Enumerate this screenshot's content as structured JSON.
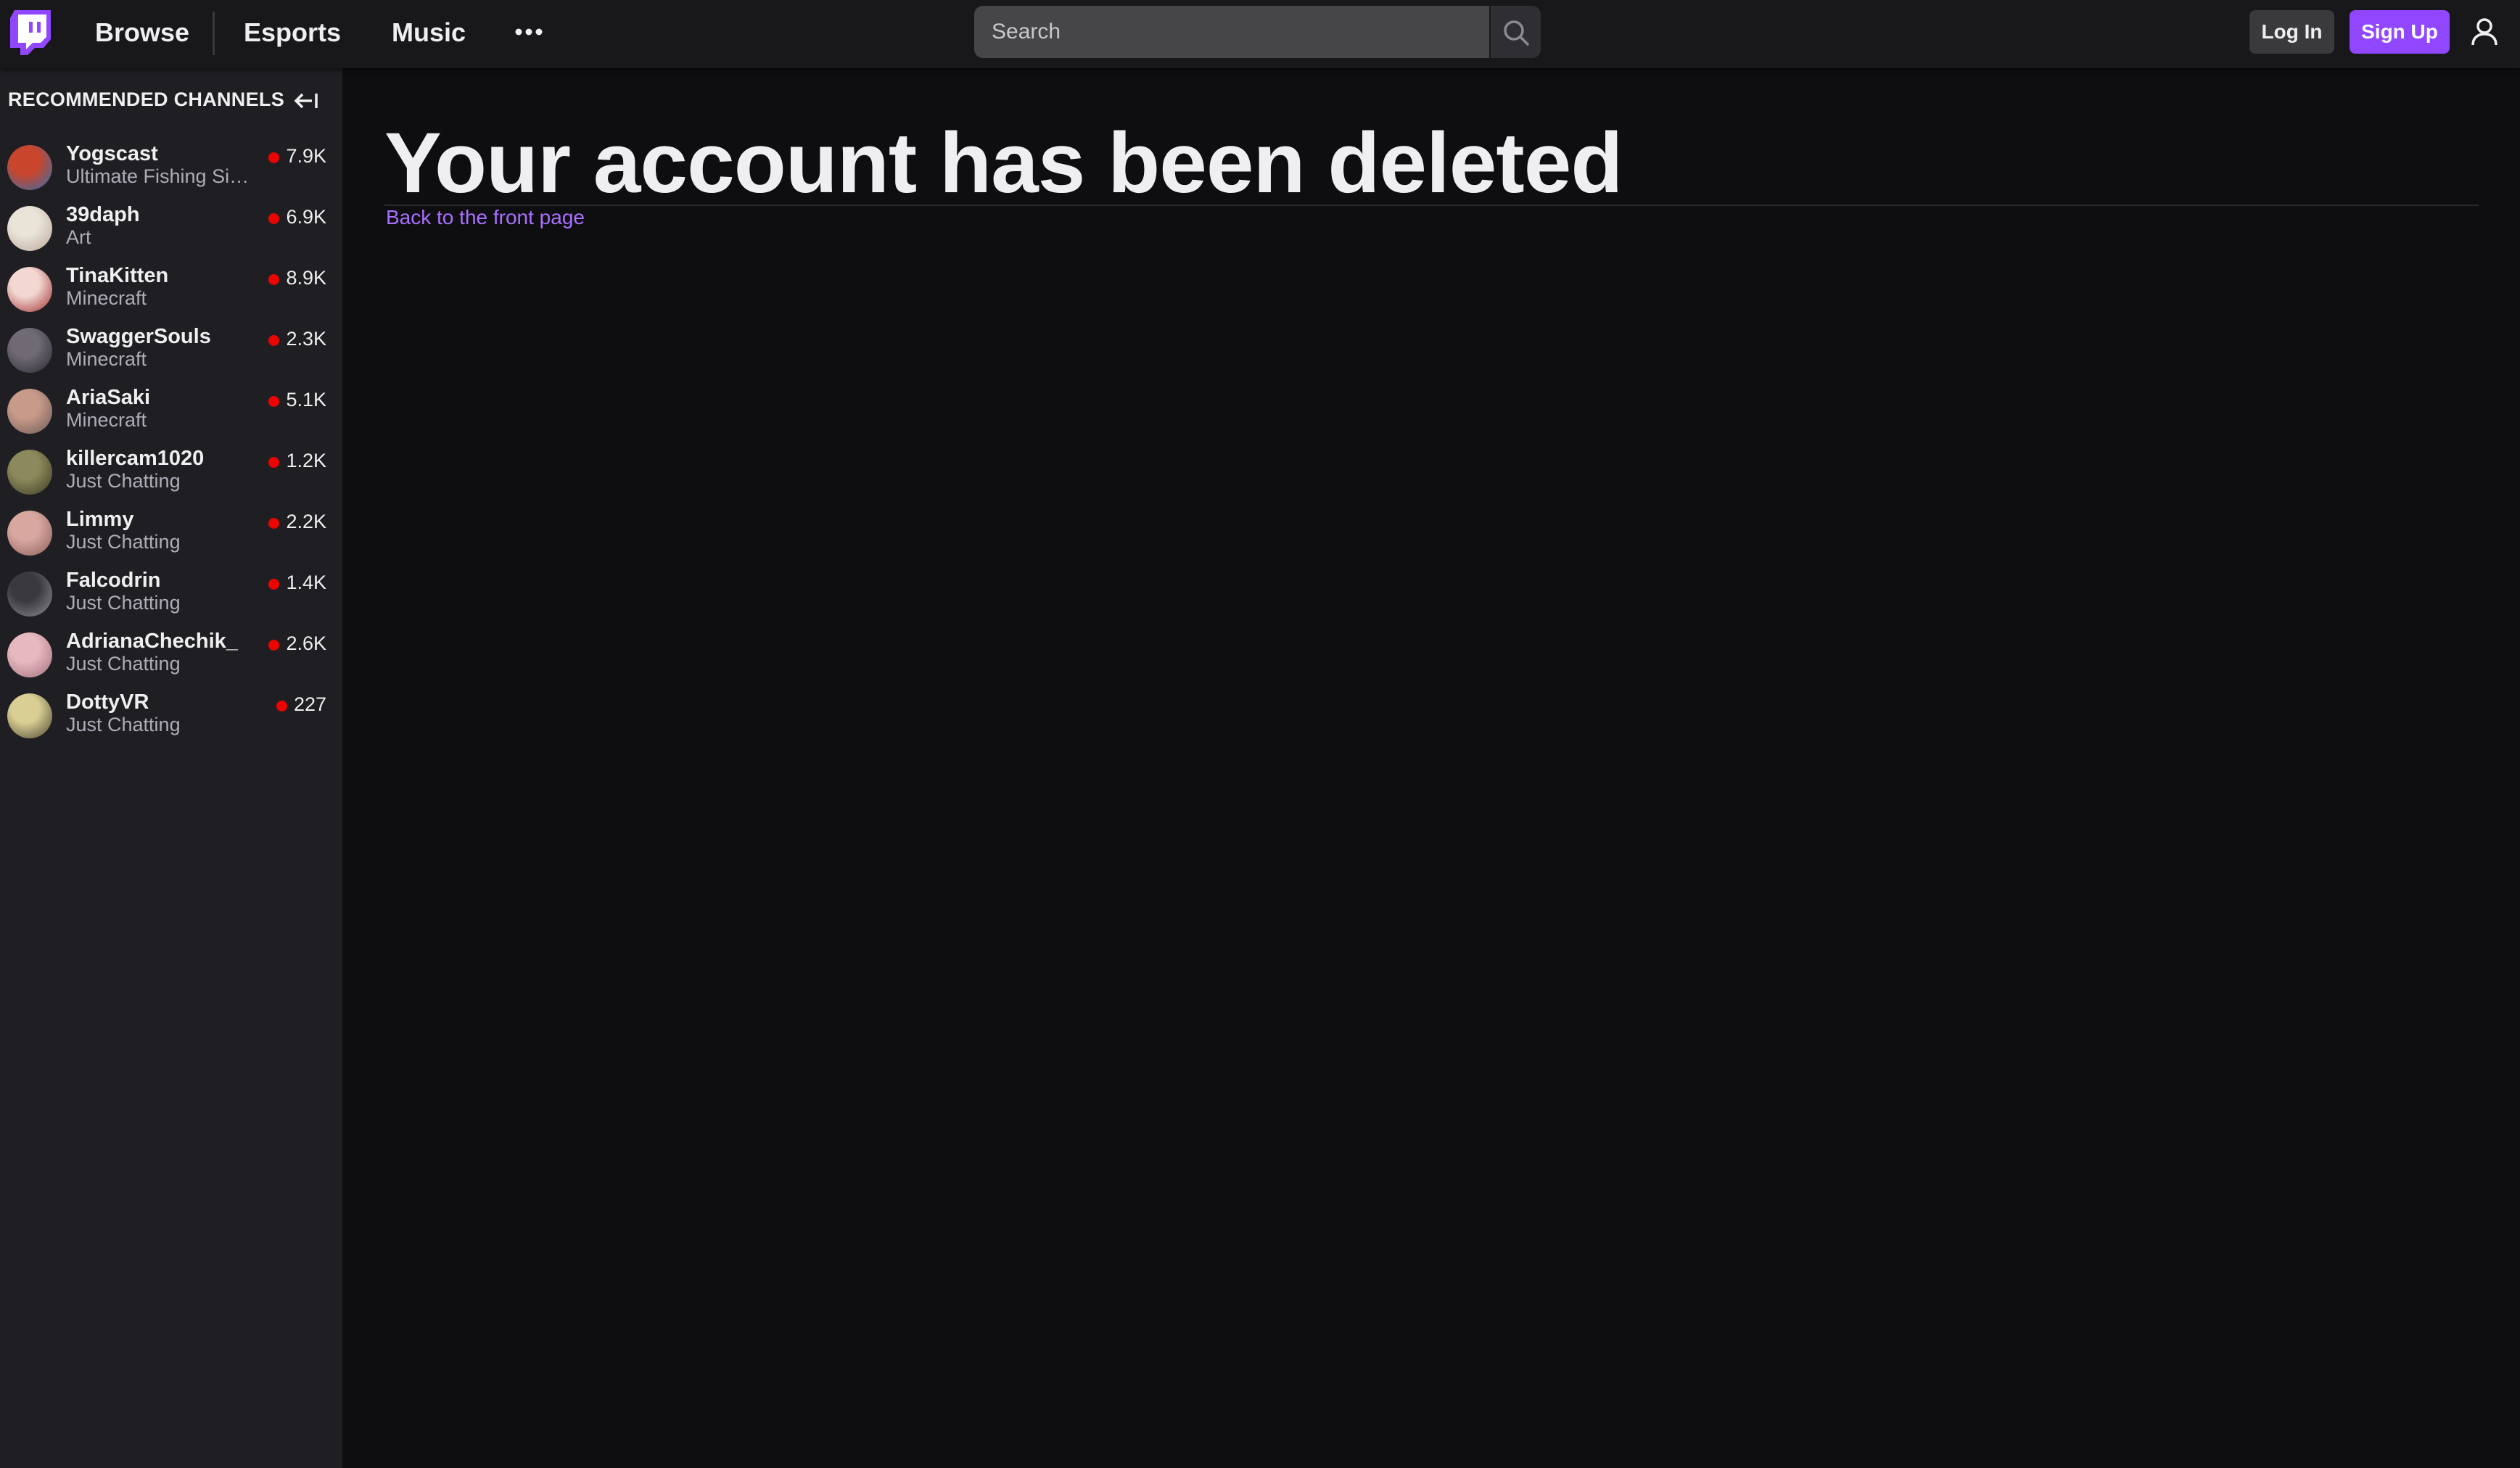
{
  "nav": {
    "links": [
      "Browse",
      "Esports",
      "Music"
    ],
    "more_icon": "more-dots-icon",
    "search_placeholder": "Search",
    "login_label": "Log In",
    "signup_label": "Sign Up",
    "brand_color": "#9147ff"
  },
  "sidebar": {
    "header": "RECOMMENDED CHANNELS",
    "collapse_icon": "collapse-arrow-icon",
    "channels": [
      {
        "name": "Yogscast",
        "game": "Ultimate Fishing Simulator",
        "viewers": "7.9K",
        "colors": [
          "#c9462c",
          "#2f6fb0"
        ]
      },
      {
        "name": "39daph",
        "game": "Art",
        "viewers": "6.9K",
        "colors": [
          "#e9e3d8",
          "#b8a897"
        ]
      },
      {
        "name": "TinaKitten",
        "game": "Minecraft",
        "viewers": "8.9K",
        "colors": [
          "#f3d8d2",
          "#9b2b2f"
        ]
      },
      {
        "name": "SwaggerSouls",
        "game": "Minecraft",
        "viewers": "2.3K",
        "colors": [
          "#6f6a74",
          "#2a2a32"
        ]
      },
      {
        "name": "AriaSaki",
        "game": "Minecraft",
        "viewers": "5.1K",
        "colors": [
          "#c89a8a",
          "#6a5a55"
        ]
      },
      {
        "name": "killercam1020",
        "game": "Just Chatting",
        "viewers": "1.2K",
        "colors": [
          "#8c8a5c",
          "#3b3a24"
        ]
      },
      {
        "name": "Limmy",
        "game": "Just Chatting",
        "viewers": "2.2K",
        "colors": [
          "#d7a7a0",
          "#8b5e58"
        ]
      },
      {
        "name": "Falcodrin",
        "game": "Just Chatting",
        "viewers": "1.4K",
        "colors": [
          "#3a3a3e",
          "#8e8e92"
        ]
      },
      {
        "name": "AdrianaChechik_",
        "game": "Just Chatting",
        "viewers": "2.6K",
        "colors": [
          "#e6b8c0",
          "#a0707a"
        ]
      },
      {
        "name": "DottyVR",
        "game": "Just Chatting",
        "viewers": "227",
        "colors": [
          "#d9cf94",
          "#4a4530"
        ]
      }
    ]
  },
  "main": {
    "title": "Your account has been deleted",
    "back_link": "Back to the front page",
    "link_color": "#a970ff"
  }
}
